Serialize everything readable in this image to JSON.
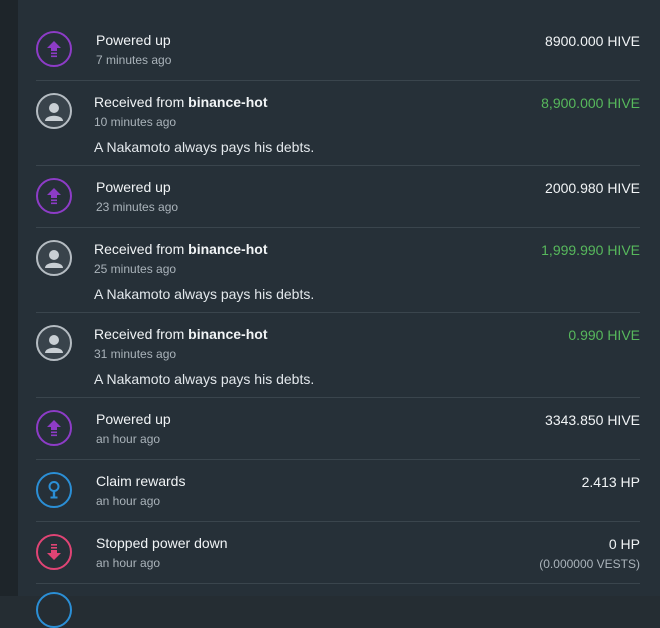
{
  "transactions": [
    {
      "title": "Powered up",
      "time": "7 minutes ago",
      "amount": "8900.000 HIVE",
      "icon": "power-up-icon"
    },
    {
      "title": "Received from ",
      "from": "binance-hot",
      "time": "10 minutes ago",
      "memo": "A Nakamoto always pays his debts.",
      "amount": "8,900.000 HIVE",
      "icon": "user-avatar-icon"
    },
    {
      "title": "Powered up",
      "time": "23 minutes ago",
      "amount": "2000.980 HIVE",
      "icon": "power-up-icon"
    },
    {
      "title": "Received from ",
      "from": "binance-hot",
      "time": "25 minutes ago",
      "memo": "A Nakamoto always pays his debts.",
      "amount": "1,999.990 HIVE",
      "icon": "user-avatar-icon"
    },
    {
      "title": "Received from ",
      "from": "binance-hot",
      "time": "31 minutes ago",
      "memo": "A Nakamoto always pays his debts.",
      "amount": "0.990 HIVE",
      "icon": "user-avatar-icon"
    },
    {
      "title": "Powered up",
      "time": "an hour ago",
      "amount": "3343.850 HIVE",
      "icon": "power-up-icon"
    },
    {
      "title": "Claim rewards",
      "time": "an hour ago",
      "amount": "2.413 HP",
      "icon": "claim-rewards-icon"
    },
    {
      "title": "Stopped power down",
      "time": "an hour ago",
      "amount": "0 HP",
      "sub_amount": "(0.000000 VESTS)",
      "icon": "stop-power-down-icon"
    }
  ],
  "colors": {
    "background": "#263038",
    "power_up": "#8d3cc7",
    "received_amount": "#57b85c",
    "claim": "#2b8fd6",
    "stop": "#e04475"
  }
}
